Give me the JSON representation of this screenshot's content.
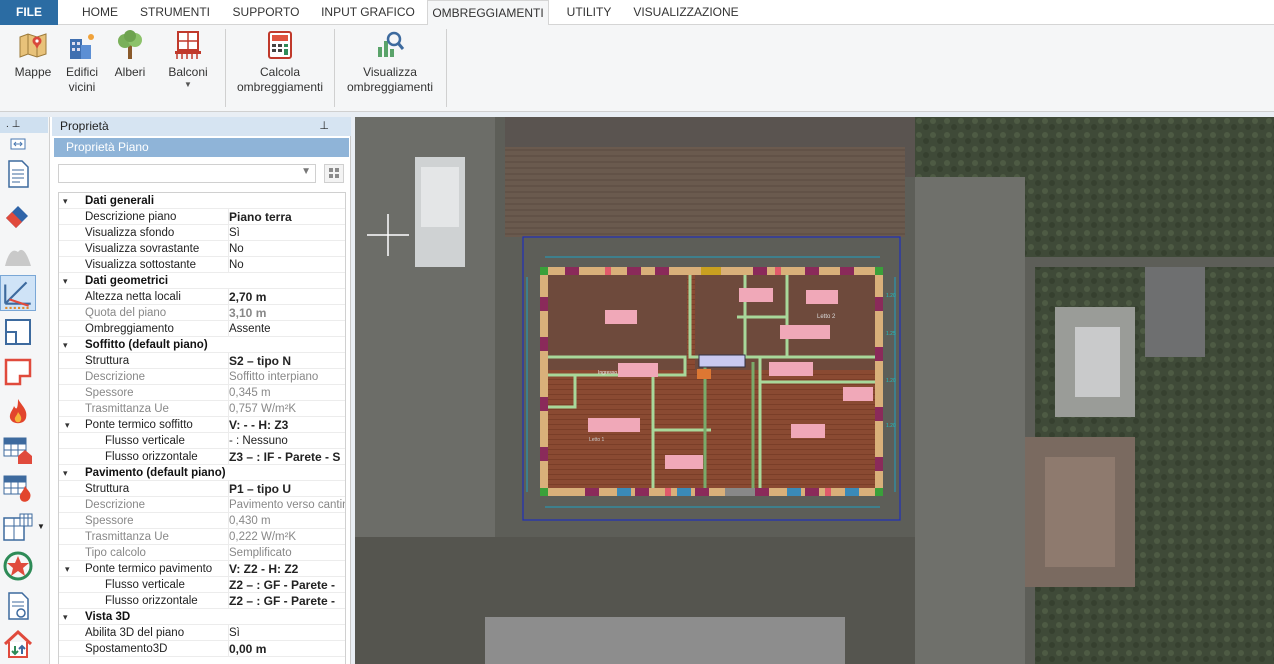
{
  "tabs": {
    "file": "FILE",
    "home": "HOME",
    "strumenti": "STRUMENTI",
    "supporto": "SUPPORTO",
    "input_grafico": "INPUT GRAFICO",
    "ombreggiamenti": "OMBREGGIAMENTI",
    "utility": "UTILITY",
    "visualizzazione": "VISUALIZZAZIONE",
    "active": "OMBREGGIAMENTI"
  },
  "ribbon": {
    "mappe": "Mappe",
    "edifici_l1": "Edifici",
    "edifici_l2": "vicini",
    "alberi": "Alberi",
    "balconi": "Balconi",
    "calcola_l1": "Calcola",
    "calcola_l2": "ombreggiamenti",
    "visualizza_l1": "Visualizza",
    "visualizza_l2": "ombreggiamenti"
  },
  "left_toolbar": {
    "head_dot": ".",
    "head_pin": "⊥",
    "icons": [
      "expand-icon",
      "document-icon",
      "eraser-icon",
      "surface-icon",
      "measure-icon",
      "floor-plan-icon",
      "room-icon",
      "flame-icon",
      "table-house-icon",
      "table-flame-icon",
      "layout-icon",
      "star-badge-icon",
      "report-icon",
      "house-arrows-icon"
    ]
  },
  "properties": {
    "title": "Proprietà",
    "subtitle": "Proprietà Piano",
    "pin": "⊥",
    "rows": [
      {
        "type": "cat",
        "label": "Dati generali"
      },
      {
        "type": "prop",
        "key": "Descrizione piano",
        "value": "Piano terra",
        "bold": true
      },
      {
        "type": "prop",
        "key": "Visualizza sfondo",
        "value": "Sì"
      },
      {
        "type": "prop",
        "key": "Visualizza sovrastante",
        "value": "No"
      },
      {
        "type": "prop",
        "key": "Visualizza sottostante",
        "value": "No"
      },
      {
        "type": "cat",
        "label": "Dati geometrici"
      },
      {
        "type": "prop",
        "key": "Altezza netta locali",
        "value": "2,70 m",
        "bold": true
      },
      {
        "type": "prop",
        "key": "Quota del piano",
        "value": "3,10 m",
        "bold": true,
        "dim": true
      },
      {
        "type": "prop",
        "key": "Ombreggiamento",
        "value": "Assente"
      },
      {
        "type": "cat",
        "label": "Soffitto (default piano)"
      },
      {
        "type": "prop",
        "key": "Struttura",
        "value": "S2 – tipo N",
        "bold": true
      },
      {
        "type": "prop",
        "key": "Descrizione",
        "value": "Soffitto interpiano",
        "dim": true
      },
      {
        "type": "prop",
        "key": "Spessore",
        "value": "0,345 m",
        "dim": true
      },
      {
        "type": "prop",
        "key": "Trasmittanza Ue",
        "value": "0,757 W/m²K",
        "dim": true
      },
      {
        "type": "sub",
        "key": "Ponte termico soffitto",
        "value": "V: - - H: Z3",
        "bold": true
      },
      {
        "type": "prop",
        "key": "Flusso verticale",
        "value": "- : Nessuno",
        "indent": true
      },
      {
        "type": "prop",
        "key": "Flusso orizzontale",
        "value": "Z3 –  : IF - Parete - S",
        "indent": true,
        "bold": true
      },
      {
        "type": "cat",
        "label": "Pavimento (default piano)"
      },
      {
        "type": "prop",
        "key": "Struttura",
        "value": "P1 – tipo U",
        "bold": true
      },
      {
        "type": "prop",
        "key": "Descrizione",
        "value": "Pavimento verso cantina",
        "dim": true
      },
      {
        "type": "prop",
        "key": "Spessore",
        "value": "0,430 m",
        "dim": true
      },
      {
        "type": "prop",
        "key": "Trasmittanza Ue",
        "value": "0,222 W/m²K",
        "dim": true
      },
      {
        "type": "prop",
        "key": "Tipo calcolo",
        "value": "Semplificato",
        "dim": true
      },
      {
        "type": "sub",
        "key": "Ponte termico pavimento",
        "value": "V: Z2 - H: Z2",
        "bold": true
      },
      {
        "type": "prop",
        "key": "Flusso verticale",
        "value": "Z2 –  : GF - Parete -",
        "indent": true,
        "bold": true
      },
      {
        "type": "prop",
        "key": "Flusso orizzontale",
        "value": "Z2 –  : GF - Parete -",
        "indent": true,
        "bold": true
      },
      {
        "type": "cat",
        "label": "Vista 3D"
      },
      {
        "type": "prop",
        "key": "Abilita 3D del piano",
        "value": "Sì"
      },
      {
        "type": "prop",
        "key": "Spostamento3D",
        "value": "0,00 m",
        "bold": true
      }
    ]
  },
  "map": {
    "room_label_1": "Ingresso",
    "room_label_2": "Bagno",
    "room_label_3": "Letto 1",
    "room_label_4": "Letto 2",
    "dim_labels": [
      "1.20",
      "1.25",
      "1.20",
      "1.20"
    ]
  }
}
